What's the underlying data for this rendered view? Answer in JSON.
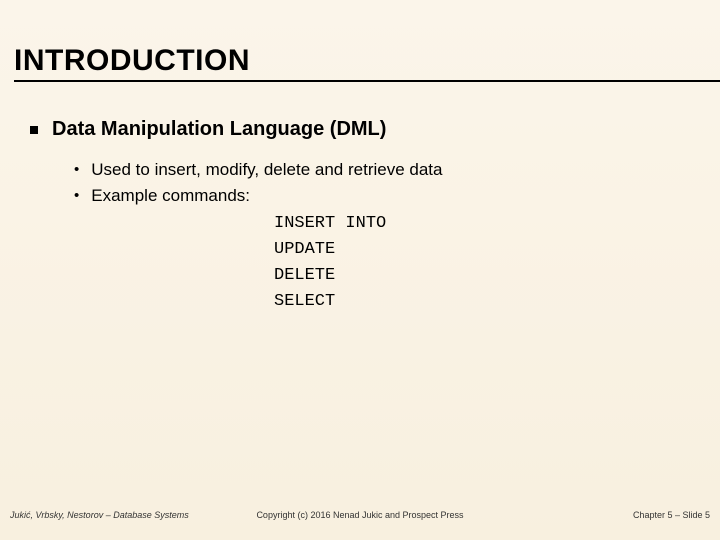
{
  "title": "INTRODUCTION",
  "main_bullet": "Data Manipulation Language (DML)",
  "sub_bullets": {
    "b0": "Used to insert, modify, delete and retrieve data",
    "b1": "Example commands:"
  },
  "commands": {
    "c0": "INSERT INTO",
    "c1": "UPDATE",
    "c2": "DELETE",
    "c3": "SELECT"
  },
  "footer": {
    "left": "Jukić, Vrbsky, Nestorov – Database Systems",
    "center": "Copyright (c) 2016 Nenad Jukic and Prospect Press",
    "right": "Chapter 5 – Slide 5"
  }
}
